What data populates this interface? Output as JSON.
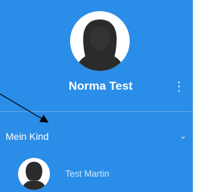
{
  "colors": {
    "panel_background": "#2a8de8",
    "text": "#ffffff",
    "avatar_background": "#ffffff",
    "avatar_silhouette": "#2b2b2b",
    "annotation_arrow": "#000000"
  },
  "profile": {
    "name": "Norma Test",
    "avatar_icon": "female-avatar-icon",
    "menu_icon": "vertical-ellipsis-icon",
    "menu_glyph": "⋮"
  },
  "section": {
    "label": "Mein Kind",
    "chevron_icon": "chevron-down-icon",
    "chevron_glyph": "⌄"
  },
  "children": [
    {
      "name": "Test Martin",
      "avatar_icon": "child-avatar-icon"
    }
  ]
}
